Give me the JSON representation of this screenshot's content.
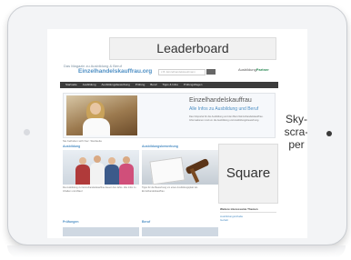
{
  "ads": {
    "leaderboard": "Leaderboard",
    "skyscraper_line1": "Sky-",
    "skyscraper_line2": "scra-",
    "skyscraper_line3": "per",
    "square": "Square"
  },
  "site": {
    "logo_small": "Das Magazin zu Ausbildung & Beruf",
    "logo": "Einzelhandelskauffrau.org",
    "search_placeholder": "z.B. Einzelhandelskaufmann",
    "partner_label": "Ausbildung",
    "partner_brand": "Partner"
  },
  "nav": {
    "items": [
      "Startseite",
      "Ausbildung",
      "Ausbildungsbewerbung",
      "Prüfung",
      "Beruf",
      "Tipps & Infos",
      "Prüfungsfragen"
    ]
  },
  "hero": {
    "title": "Einzelhandelskauffrau",
    "subtitle": "Alle Infos zu Ausbildung und Beruf",
    "text": "Das Infoportal für die Ausbildung und den Beruf Einzelhandelskauffrau. Informationen rund um die Ausbildung und Ausbildungsbewerbung."
  },
  "breadcrumb": "Sie befinden sich hier: Startseite",
  "columns": [
    {
      "title": "Ausbildung",
      "text": "Die Ausbildung zur Einzelhandelskauffrau dauert drei Jahre. Alle Infos zu Inhalten und Ablauf."
    },
    {
      "title": "Ausbildungsbewerbung",
      "text": "Tipps für die Bewerbung um einen Ausbildungsplatz als Einzelhandelskauffrau."
    }
  ],
  "popular": {
    "heading": "Weitere interessante Themen",
    "links": [
      "Ausbildungsinhalte",
      "Gehalt"
    ]
  },
  "bottom": {
    "left_title": "Prüfungen",
    "right_title": "Beruf"
  }
}
